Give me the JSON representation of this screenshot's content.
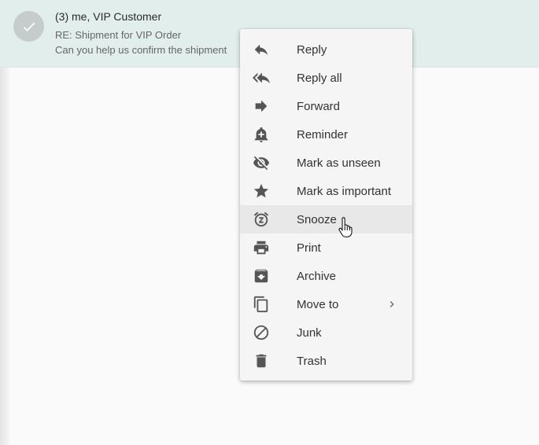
{
  "email": {
    "sender": "(3) me, VIP Customer",
    "subject": "RE: Shipment for VIP Order",
    "preview": "Can you help us confirm the shipment"
  },
  "context_menu": {
    "items": [
      {
        "label": "Reply",
        "icon": "reply-icon"
      },
      {
        "label": "Reply all",
        "icon": "reply-all-icon"
      },
      {
        "label": "Forward",
        "icon": "forward-icon"
      },
      {
        "label": "Reminder",
        "icon": "bell-plus-icon"
      },
      {
        "label": "Mark as unseen",
        "icon": "eye-off-icon"
      },
      {
        "label": "Mark as important",
        "icon": "star-icon"
      },
      {
        "label": "Snooze",
        "icon": "snooze-alarm-icon",
        "hovered": true
      },
      {
        "label": "Print",
        "icon": "printer-icon"
      },
      {
        "label": "Archive",
        "icon": "archive-icon"
      },
      {
        "label": "Move to",
        "icon": "copy-icon",
        "has_submenu": true
      },
      {
        "label": "Junk",
        "icon": "block-icon"
      },
      {
        "label": "Trash",
        "icon": "trash-icon"
      }
    ]
  },
  "colors": {
    "selected_row_bg": "#e1eeec",
    "menu_bg": "#f5f5f5",
    "hover_bg": "#e8e8e8",
    "icon": "#555555"
  }
}
